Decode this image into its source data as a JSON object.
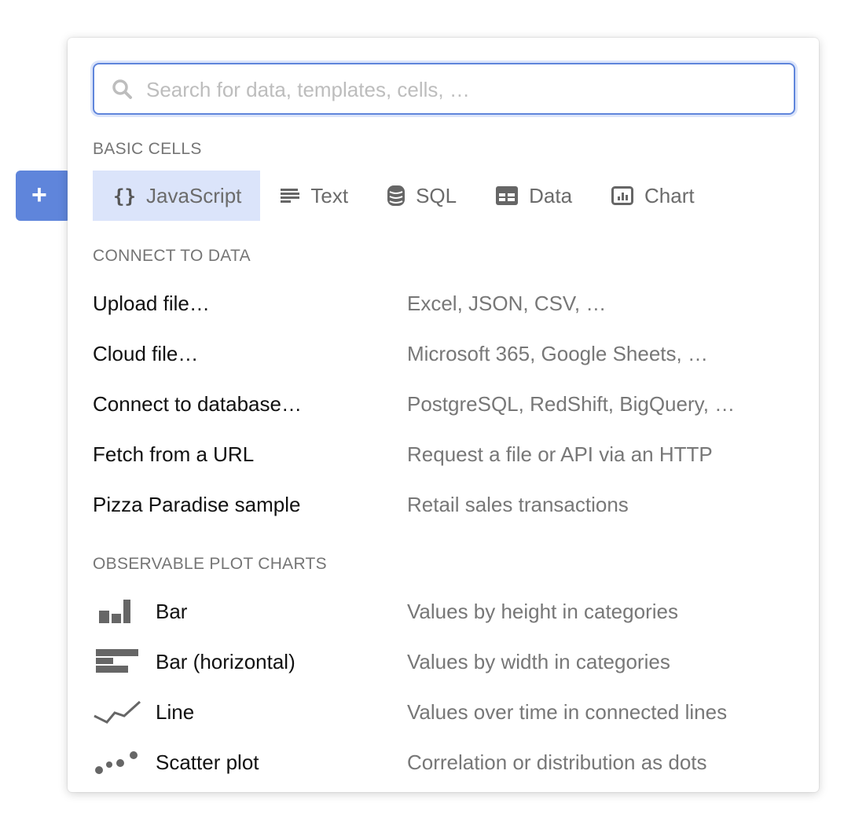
{
  "add_button": {
    "label": "+"
  },
  "search": {
    "placeholder": "Search for data, templates, cells, …",
    "value": ""
  },
  "basic_cells": {
    "heading": "BASIC CELLS",
    "items": [
      {
        "label": "JavaScript",
        "icon": "braces-icon",
        "selected": true
      },
      {
        "label": "Text",
        "icon": "text-lines-icon"
      },
      {
        "label": "SQL",
        "icon": "database-icon"
      },
      {
        "label": "Data",
        "icon": "table-icon"
      },
      {
        "label": "Chart",
        "icon": "chart-icon"
      }
    ]
  },
  "connect": {
    "heading": "CONNECT TO DATA",
    "items": [
      {
        "label": "Upload file…",
        "desc": "Excel, JSON, CSV, …"
      },
      {
        "label": "Cloud file…",
        "desc": "Microsoft 365, Google Sheets, …"
      },
      {
        "label": "Connect to database…",
        "desc": "PostgreSQL, RedShift, BigQuery, …"
      },
      {
        "label": "Fetch from a URL",
        "desc": "Request a file or API via an HTTP"
      },
      {
        "label": "Pizza Paradise sample",
        "desc": "Retail sales transactions"
      }
    ]
  },
  "plot": {
    "heading": "OBSERVABLE PLOT CHARTS",
    "items": [
      {
        "label": "Bar",
        "desc": "Values by height in categories",
        "icon": "bar-chart-icon"
      },
      {
        "label": "Bar (horizontal)",
        "desc": "Values by width in categories",
        "icon": "horizontal-bar-chart-icon"
      },
      {
        "label": "Line",
        "desc": "Values over time in connected lines",
        "icon": "line-chart-icon"
      },
      {
        "label": "Scatter plot",
        "desc": "Correlation or distribution as dots",
        "icon": "scatter-plot-icon"
      }
    ]
  },
  "colors": {
    "accent": "#5f85db",
    "selected_bg": "#dbe4fa"
  }
}
